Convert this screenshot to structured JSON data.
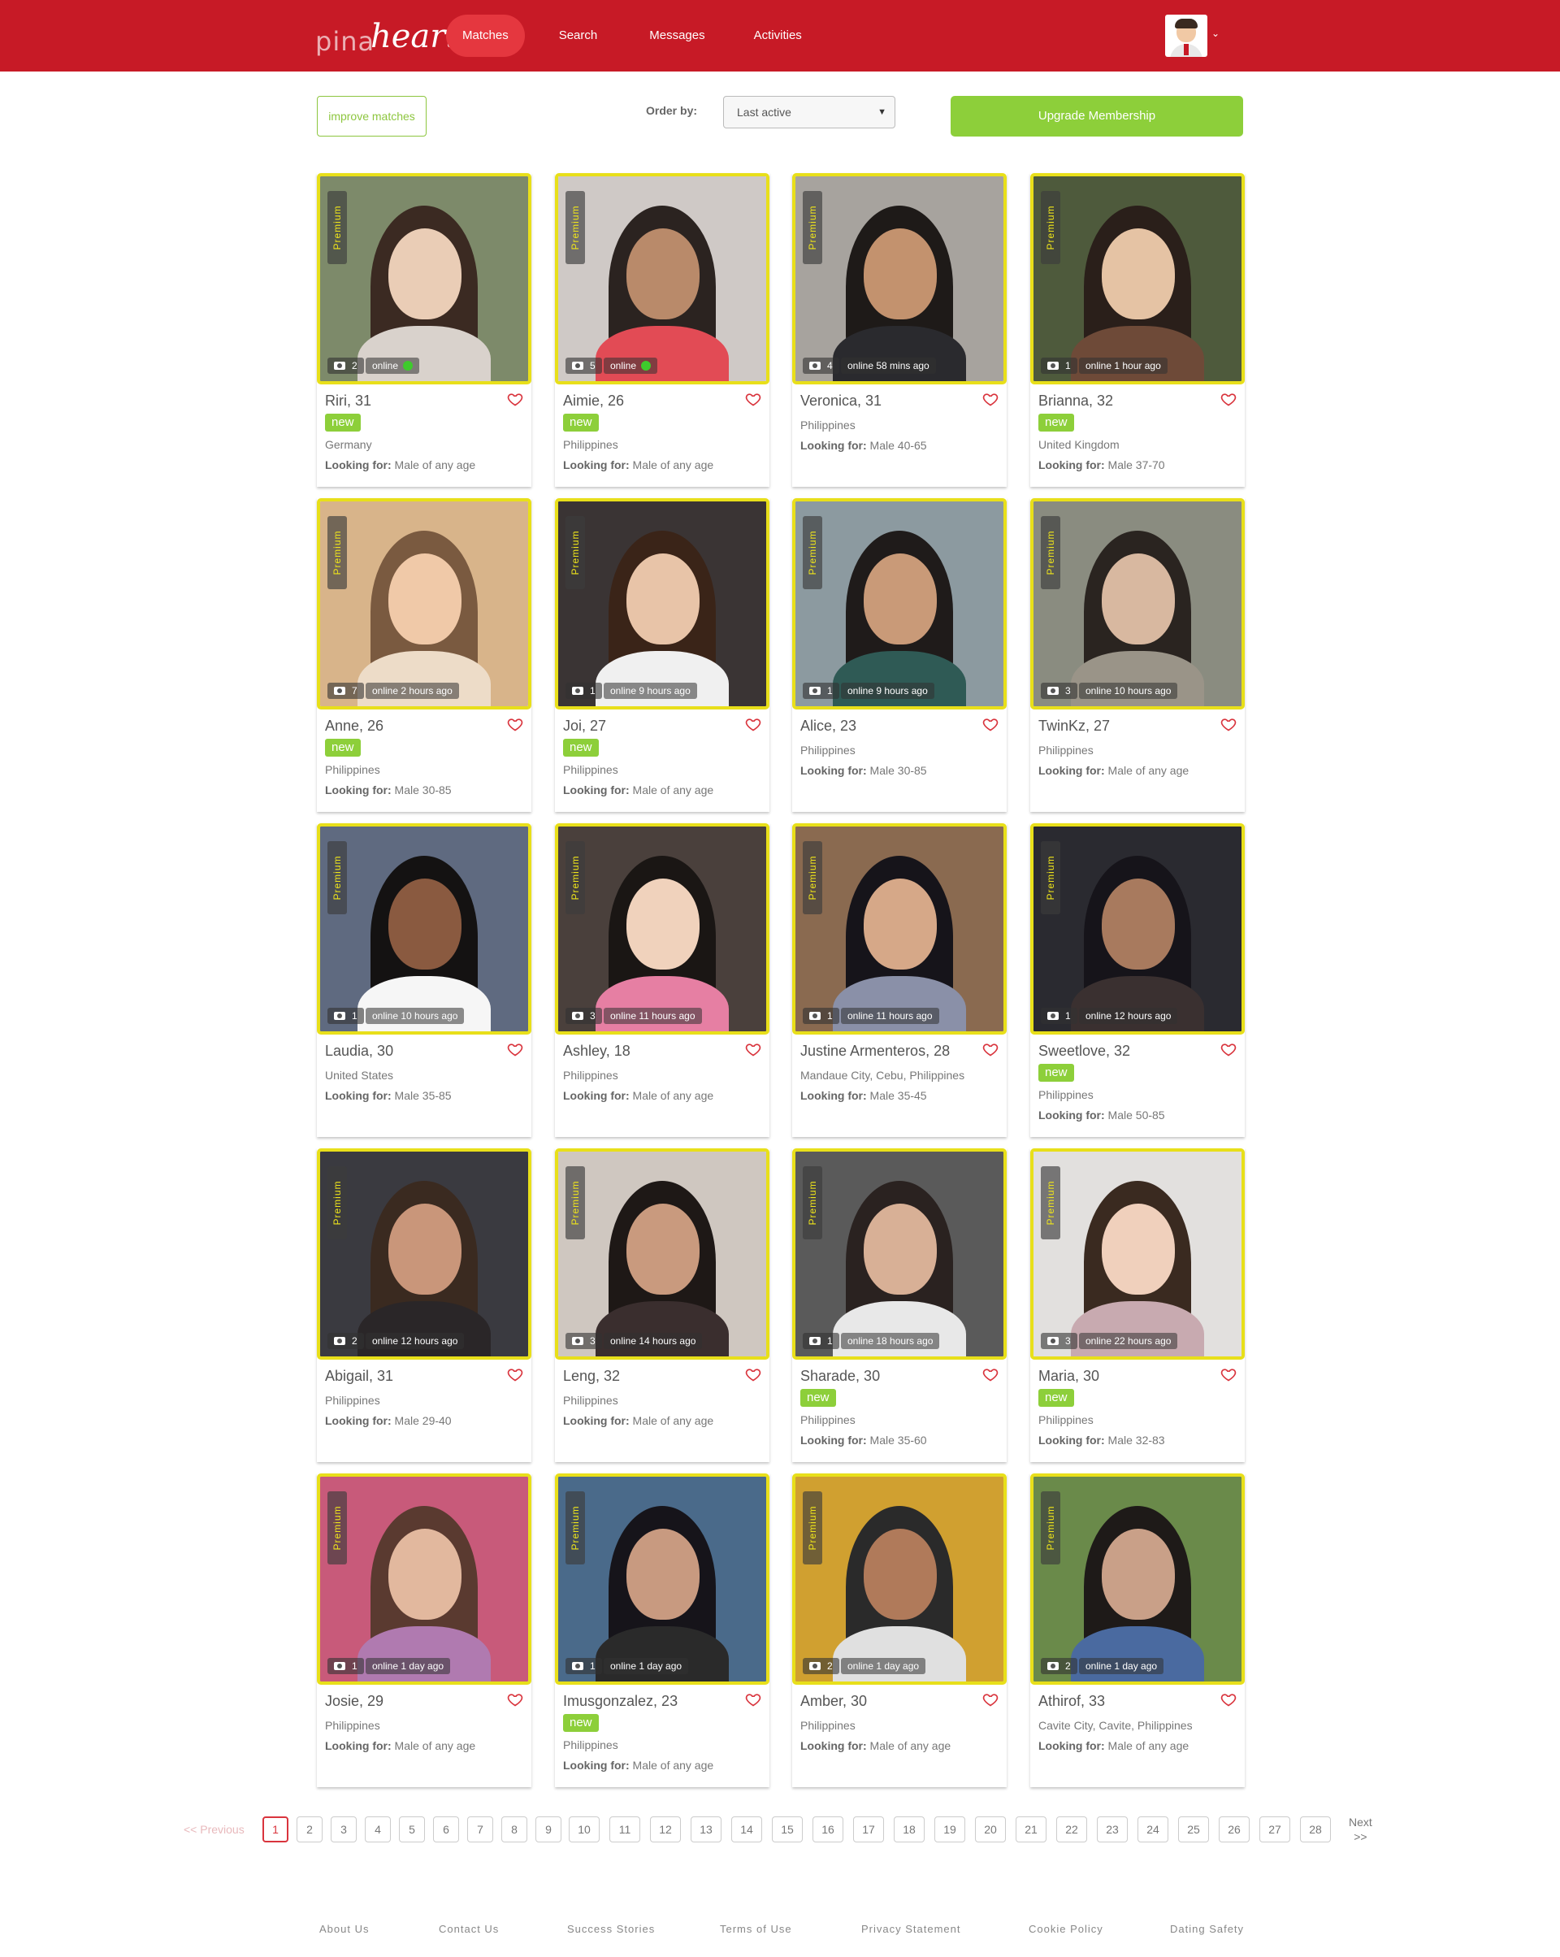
{
  "header": {
    "logo_part1": "pina",
    "logo_part2": "heart",
    "nav": [
      {
        "label": "Matches",
        "active": true
      },
      {
        "label": "Search"
      },
      {
        "label": "Messages"
      },
      {
        "label": "Activities"
      }
    ]
  },
  "toolbar": {
    "improve_label": "improve matches",
    "order_label": "Order by:",
    "order_value": "Last active",
    "upgrade_label": "Upgrade Membership"
  },
  "premium_label": "Premium",
  "new_label": "new",
  "looking_for_label": "Looking for:",
  "profiles": [
    {
      "name": "Riri, 31",
      "new": true,
      "country": "Germany",
      "looking": "Male of any age",
      "photos": "2",
      "status": "online",
      "online_now": true
    },
    {
      "name": "Aimie, 26",
      "new": true,
      "country": "Philippines",
      "looking": "Male of any age",
      "photos": "5",
      "status": "online",
      "online_now": true
    },
    {
      "name": "Veronica, 31",
      "new": false,
      "country": "Philippines",
      "looking": "Male 40-65",
      "photos": "4",
      "status": "online 58 mins ago",
      "online_now": false
    },
    {
      "name": "Brianna, 32",
      "new": true,
      "country": "United Kingdom",
      "looking": "Male 37-70",
      "photos": "1",
      "status": "online 1 hour ago",
      "online_now": false
    },
    {
      "name": "Anne, 26",
      "new": true,
      "country": "Philippines",
      "looking": "Male 30-85",
      "photos": "7",
      "status": "online 2 hours ago",
      "online_now": false
    },
    {
      "name": "Joi, 27",
      "new": true,
      "country": "Philippines",
      "looking": "Male of any age",
      "photos": "1",
      "status": "online 9 hours ago",
      "online_now": false
    },
    {
      "name": "Alice, 23",
      "new": false,
      "country": "Philippines",
      "looking": "Male 30-85",
      "photos": "1",
      "status": "online 9 hours ago",
      "online_now": false
    },
    {
      "name": "TwinKz, 27",
      "new": false,
      "country": "Philippines",
      "looking": "Male of any age",
      "photos": "3",
      "status": "online 10 hours ago",
      "online_now": false
    },
    {
      "name": "Laudia, 30",
      "new": false,
      "country": "United States",
      "looking": "Male 35-85",
      "photos": "1",
      "status": "online 10 hours ago",
      "online_now": false
    },
    {
      "name": "Ashley, 18",
      "new": false,
      "country": "Philippines",
      "looking": "Male of any age",
      "photos": "3",
      "status": "online 11 hours ago",
      "online_now": false
    },
    {
      "name": "Justine Armenteros, 28",
      "new": false,
      "country": "Mandaue City, Cebu, Philippines",
      "looking": "Male 35-45",
      "photos": "1",
      "status": "online 11 hours ago",
      "online_now": false
    },
    {
      "name": "Sweetlove, 32",
      "new": true,
      "country": "Philippines",
      "looking": "Male 50-85",
      "photos": "1",
      "status": "online 12 hours ago",
      "online_now": false
    },
    {
      "name": "Abigail, 31",
      "new": false,
      "country": "Philippines",
      "looking": "Male 29-40",
      "photos": "2",
      "status": "online 12 hours ago",
      "online_now": false
    },
    {
      "name": "Leng, 32",
      "new": false,
      "country": "Philippines",
      "looking": "Male of any age",
      "photos": "3",
      "status": "online 14 hours ago",
      "online_now": false
    },
    {
      "name": "Sharade, 30",
      "new": true,
      "country": "Philippines",
      "looking": "Male 35-60",
      "photos": "1",
      "status": "online 18 hours ago",
      "online_now": false
    },
    {
      "name": "Maria, 30",
      "new": true,
      "country": "Philippines",
      "looking": "Male 32-83",
      "photos": "3",
      "status": "online 22 hours ago",
      "online_now": false
    },
    {
      "name": "Josie, 29",
      "new": false,
      "country": "Philippines",
      "looking": "Male of any age",
      "photos": "1",
      "status": "online 1 day ago",
      "online_now": false
    },
    {
      "name": "Imusgonzalez, 23",
      "new": true,
      "country": "Philippines",
      "looking": "Male of any age",
      "photos": "1",
      "status": "online 1 day ago",
      "online_now": false
    },
    {
      "name": "Amber, 30",
      "new": false,
      "country": "Philippines",
      "looking": "Male of any age",
      "photos": "2",
      "status": "online 1 day ago",
      "online_now": false
    },
    {
      "name": "Athirof, 33",
      "new": false,
      "country": "Cavite City, Cavite, Philippines",
      "looking": "Male of any age",
      "photos": "2",
      "status": "online 1 day ago",
      "online_now": false
    }
  ],
  "pagination": {
    "prev": "<< Previous",
    "pages": [
      "1",
      "2",
      "3",
      "4",
      "5",
      "6",
      "7",
      "8",
      "9",
      "10",
      "11",
      "12",
      "13",
      "14",
      "15",
      "16",
      "17",
      "18",
      "19",
      "20",
      "21",
      "22",
      "23",
      "24",
      "25",
      "26",
      "27",
      "28"
    ],
    "current": "1",
    "next_line1": "Next",
    "next_line2": ">>"
  },
  "footer": {
    "links": [
      "About Us",
      "Contact Us",
      "Success Stories",
      "Terms of Use",
      "Privacy Statement",
      "Cookie Policy",
      "Dating Safety"
    ]
  },
  "colors": {
    "header_bg": "#c71a26",
    "nav_active_bg": "#e5373f",
    "accent_green": "#8dcf3a",
    "premium_border": "#e8df1a",
    "heart_icon": "#d9343d",
    "online_dot": "#3ecb2c"
  },
  "icons": [
    "camera-icon",
    "heart-outline-icon",
    "chevron-down-icon",
    "online-dot-icon"
  ]
}
